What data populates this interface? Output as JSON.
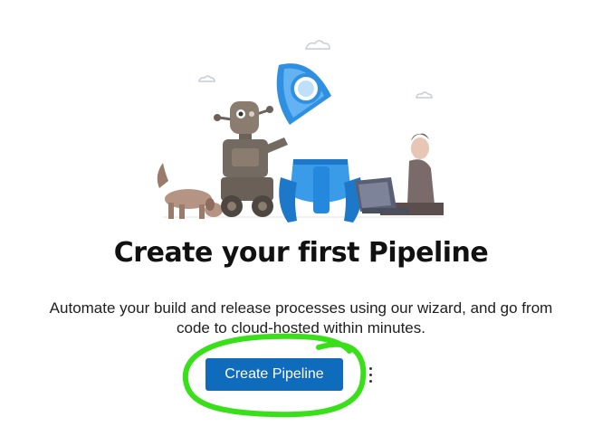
{
  "empty_state": {
    "title": "Create your first Pipeline",
    "description_line1": "Automate your build and release processes using our wizard, and go from",
    "description_line2": "code to cloud-hosted within minutes."
  },
  "actions": {
    "primary_label": "Create Pipeline",
    "more_icon": "more-vertical-icon"
  },
  "colors": {
    "primary": "#0f6cbd",
    "highlight_annotation": "#39e01a"
  }
}
